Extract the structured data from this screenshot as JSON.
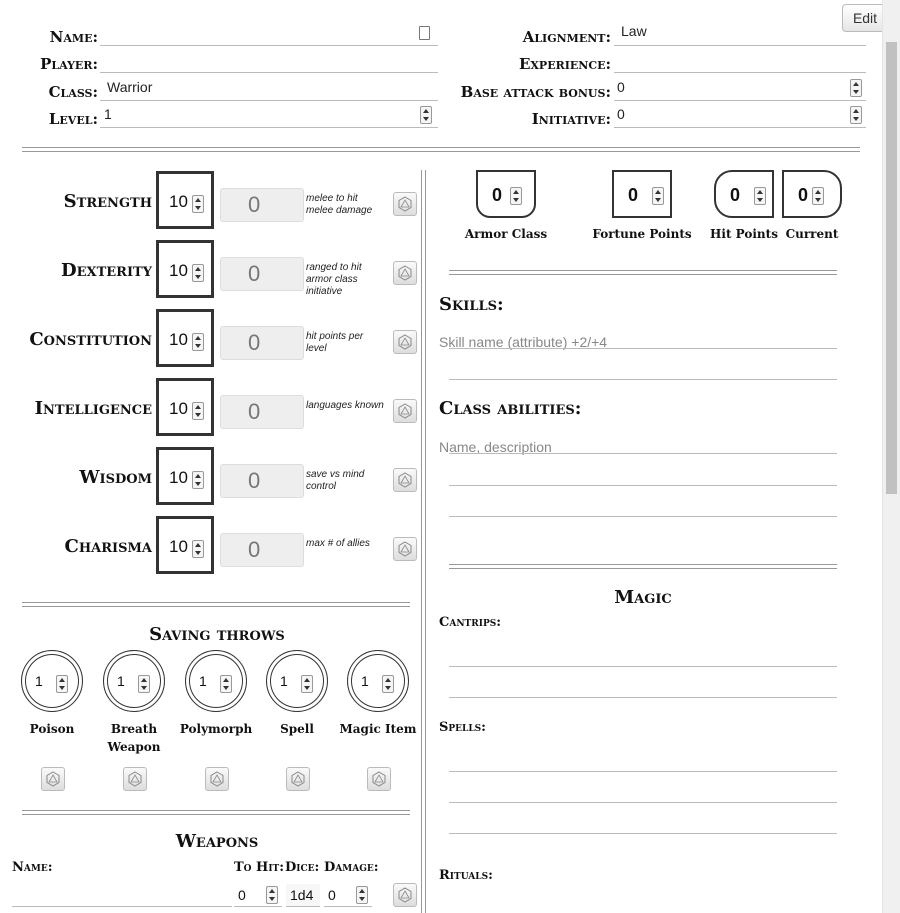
{
  "header": {
    "name_label": "Name:",
    "player_label": "Player:",
    "class_label": "Class:",
    "class_value": "Warrior",
    "level_label": "Level:",
    "level_value": "1",
    "alignment_label": "Alignment:",
    "alignment_value": "Law",
    "experience_label": "Experience:",
    "bab_label": "Base attack bonus:",
    "bab_value": "0",
    "initiative_label": "Initiative:",
    "initiative_value": "0"
  },
  "edit_label": "Edit",
  "attributes": [
    {
      "name": "Strength",
      "score": "10",
      "mod": "0",
      "note": "melee to hit melee damage"
    },
    {
      "name": "Dexterity",
      "score": "10",
      "mod": "0",
      "note": "ranged to hit armor class initiative"
    },
    {
      "name": "Constitution",
      "score": "10",
      "mod": "0",
      "note": "hit points per level"
    },
    {
      "name": "Intelligence",
      "score": "10",
      "mod": "0",
      "note": "languages known"
    },
    {
      "name": "Wisdom",
      "score": "10",
      "mod": "0",
      "note": "save vs mind control"
    },
    {
      "name": "Charisma",
      "score": "10",
      "mod": "0",
      "note": "max # of allies"
    }
  ],
  "saving_throws": {
    "title": "Saving throws",
    "items": [
      {
        "label": "Poison",
        "value": "1"
      },
      {
        "label": "Breath Weapon",
        "value": "1"
      },
      {
        "label": "Polymorph",
        "value": "1"
      },
      {
        "label": "Spell",
        "value": "1"
      },
      {
        "label": "Magic Item",
        "value": "1"
      }
    ]
  },
  "weapons": {
    "title": "Weapons",
    "name_label": "Name:",
    "tohit_label": "To Hit:",
    "dice_label": "Dice:",
    "damage_label": "Damage:",
    "row": {
      "tohit": "0",
      "dice": "1d4",
      "damage": "0"
    }
  },
  "combat": {
    "armor_class": {
      "label": "Armor Class",
      "value": "0"
    },
    "fortune_points": {
      "label": "Fortune Points",
      "value": "0"
    },
    "hit_points": {
      "label": "Hit Points",
      "value": "0"
    },
    "current": {
      "label": "Current",
      "value": "0"
    }
  },
  "skills": {
    "title": "Skills:",
    "placeholder": "Skill name (attribute) +2/+4"
  },
  "class_abilities": {
    "title": "Class abilities:",
    "placeholder": "Name, description"
  },
  "magic": {
    "title": "Magic",
    "cantrips_label": "Cantrips:",
    "spells_label": "Spells:",
    "rituals_label": "Rituals:"
  }
}
